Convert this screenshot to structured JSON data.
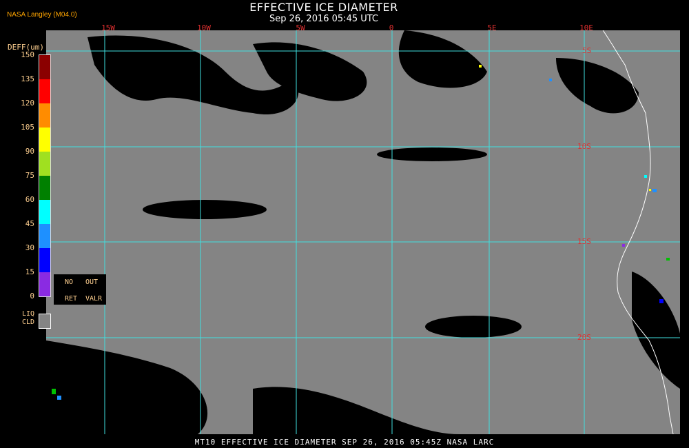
{
  "header": {
    "title": "EFFECTIVE ICE DIAMETER",
    "subtitle": "Sep 26, 2016 05:45 UTC",
    "corner_label": "NASA Langley (M04.0)"
  },
  "map": {
    "lon_labels": [
      "15W",
      "10W",
      "5W",
      "0",
      "5E",
      "10E"
    ],
    "lat_labels": [
      "5S",
      "10S",
      "15S",
      "20S"
    ],
    "grid_color": "#40e0e0",
    "label_color": "#e03030",
    "background_color": "#848484",
    "coastline_color": "#ffffff"
  },
  "legend": {
    "title": "DEFF(um)",
    "ticks": [
      "150",
      "135",
      "120",
      "105",
      "90",
      "75",
      "60",
      "45",
      "30",
      "15",
      "0"
    ],
    "colors": [
      "#8b0000",
      "#ff0000",
      "#ff8c00",
      "#ffff00",
      "#a0e020",
      "#008000",
      "#00ffff",
      "#1e90ff",
      "#0000ff",
      "#8a2be2"
    ],
    "no_ret": {
      "no": "NO",
      "ret": "RET",
      "out": "OUT",
      "valr": "VALR"
    },
    "liq_label_1": "LIQ",
    "liq_label_2": "CLD"
  },
  "footer": {
    "text": "MT10  EFFECTIVE ICE DIAMETER  SEP 26, 2016 05:45Z  NASA LARC"
  }
}
